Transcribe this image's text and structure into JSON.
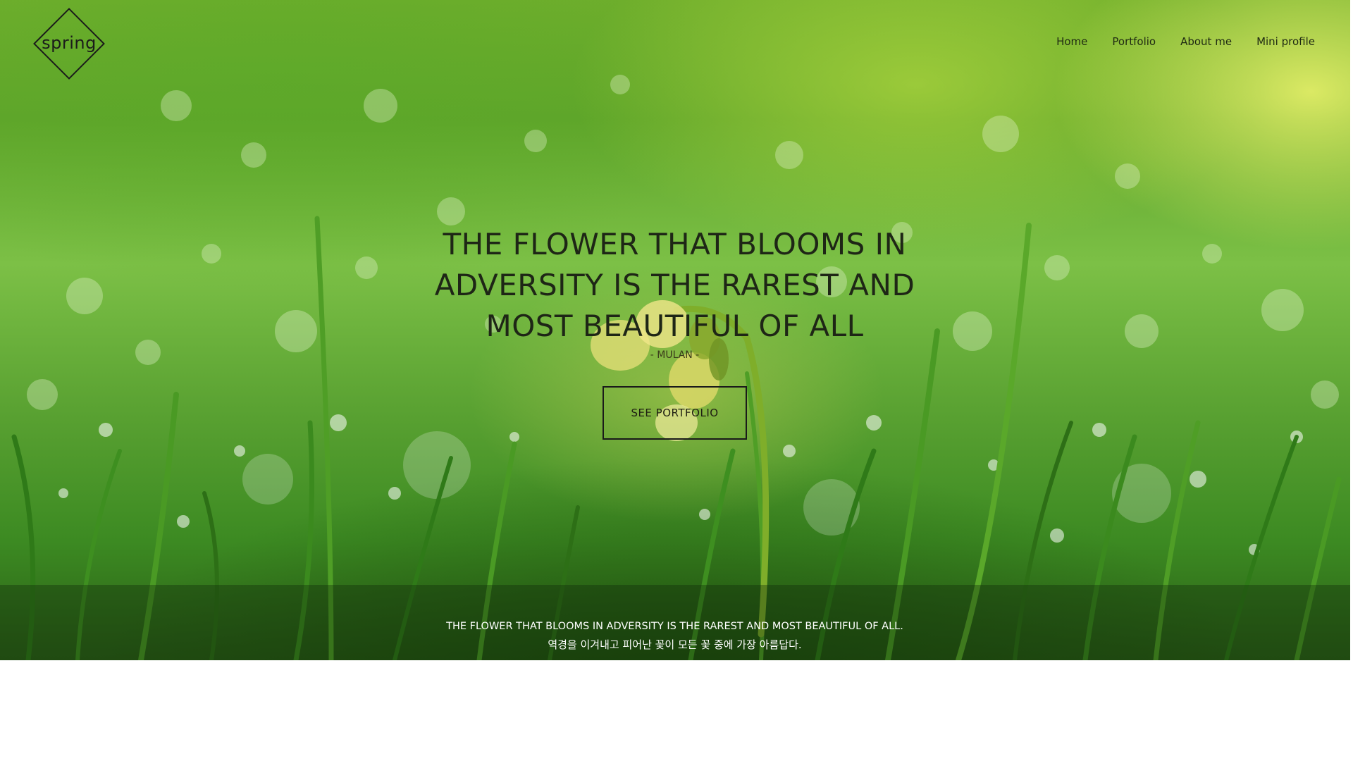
{
  "brand": {
    "logo_text": "spring"
  },
  "nav": {
    "items": [
      "Home",
      "Portfolio",
      "About me",
      "Mini profile"
    ]
  },
  "hero": {
    "headline_lines": [
      "THE FLOWER THAT BLOOMS IN",
      "ADVERSITY IS THE RAREST AND",
      "MOST BEAUTIFUL OF ALL"
    ],
    "attribution": "- MULAN -",
    "cta_label": "SEE PORTFOLIO"
  },
  "caption": {
    "english": "THE FLOWER THAT BLOOMS IN ADVERSITY IS THE RAREST AND MOST BEAUTIFUL OF ALL.",
    "korean": "역경을 이겨내고 피어난 꽃이 모든 꽃 중에 가장 아름답다."
  },
  "colors": {
    "text_dark": "#1e2616",
    "caption_text": "#ffffff",
    "page_background": "#ffffff"
  }
}
